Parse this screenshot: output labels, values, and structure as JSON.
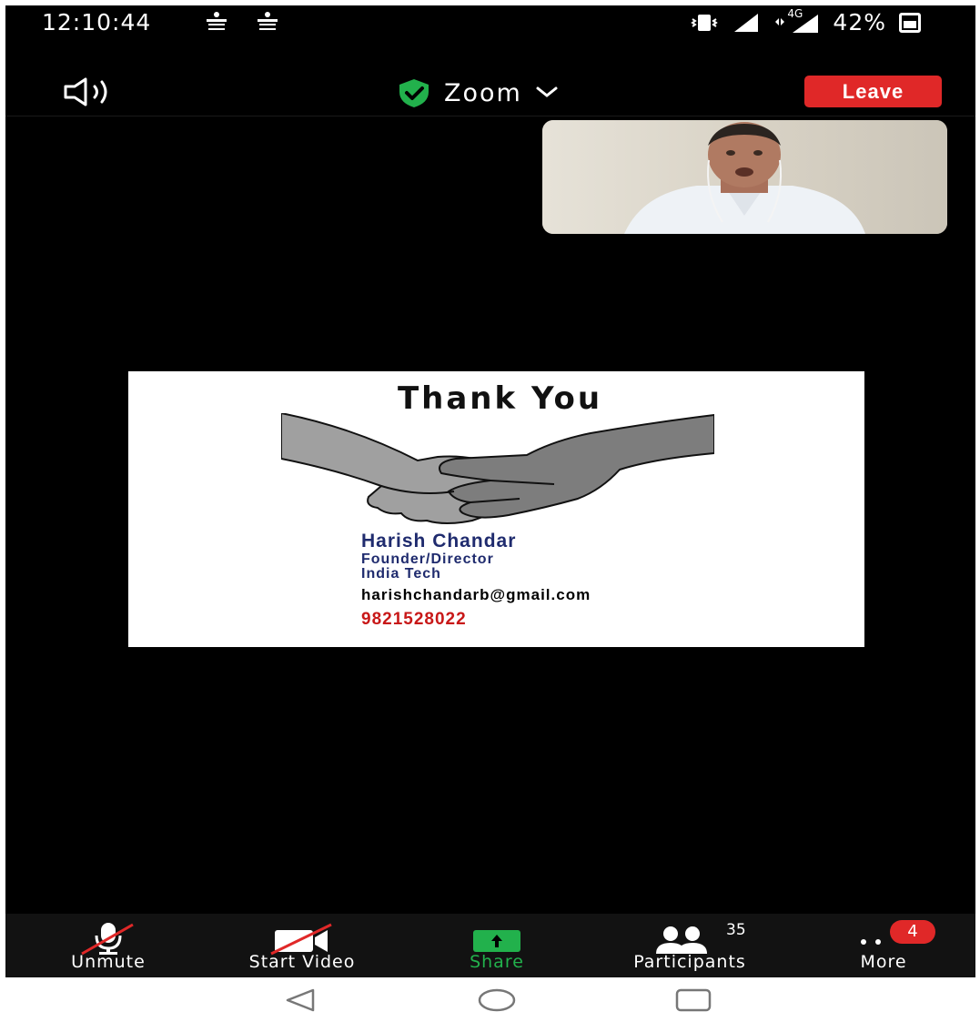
{
  "status_bar": {
    "time": "12:10:44",
    "network_label": "4G",
    "battery": "42%"
  },
  "header": {
    "title": "Zoom",
    "leave_label": "Leave"
  },
  "slide": {
    "title": "Thank You",
    "name": "Harish Chandar",
    "role": "Founder/Director",
    "company": "India Tech",
    "email": "harishchandarb@gmail.com",
    "phone": "9821528022"
  },
  "toolbar": {
    "unmute_label": "Unmute",
    "video_label": "Start Video",
    "share_label": "Share",
    "participants_label": "Participants",
    "participant_count": "35",
    "more_label": "More",
    "more_badge": "4"
  },
  "colors": {
    "leave": "#e02828",
    "share": "#22b14c",
    "shield": "#22b14c",
    "slide_name": "#1f2b6e",
    "slide_phone": "#c81818"
  },
  "icons": [
    "speaker-icon",
    "shield-check-icon",
    "chevron-down-icon",
    "mic-off-icon",
    "video-off-icon",
    "share-up-icon",
    "participants-icon",
    "more-dots-icon",
    "back-icon",
    "home-icon",
    "recents-icon"
  ]
}
